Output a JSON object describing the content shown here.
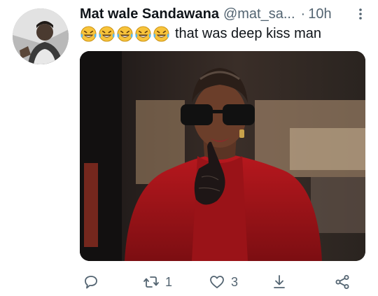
{
  "tweet": {
    "author_name": "Mat wale Sandawana",
    "author_handle": "@mat_sa...",
    "separator": "·",
    "time": "10h",
    "text": "that was deep kiss man",
    "emoji": [
      "laughing-tears",
      "laughing-tears",
      "laughing-tears",
      "laughing-tears",
      "laughing-tears"
    ]
  },
  "actions": {
    "reply_count": "",
    "retweet_count": "1",
    "like_count": "3"
  },
  "colors": {
    "text": "#0f1419",
    "muted": "#536471",
    "coat_red": "#a3151b",
    "emoji_yellow": "#f7c33b"
  },
  "icons": [
    "more-vertical-icon",
    "reply-icon",
    "retweet-icon",
    "like-icon",
    "download-icon",
    "share-icon"
  ]
}
